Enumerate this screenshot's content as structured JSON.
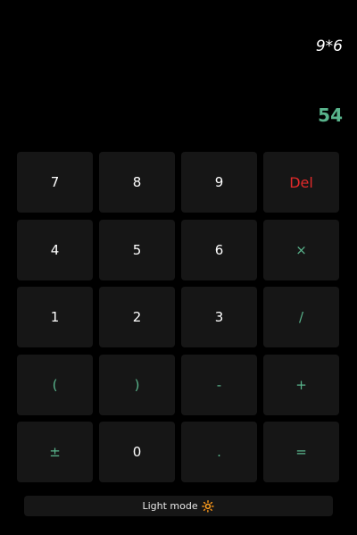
{
  "display": {
    "expression": "9*6",
    "result": "54"
  },
  "colors": {
    "background": "#000000",
    "key_background": "#161616",
    "number_text": "#ffffff",
    "operator_text": "#59b48c",
    "delete_text": "#e22a2a",
    "result_text": "#59b48c",
    "sun_icon": "#ff9a2e"
  },
  "keys": [
    {
      "label": "7",
      "kind": "num",
      "name": "key-7"
    },
    {
      "label": "8",
      "kind": "num",
      "name": "key-8"
    },
    {
      "label": "9",
      "kind": "num",
      "name": "key-9"
    },
    {
      "label": "Del",
      "kind": "del",
      "name": "delete-button"
    },
    {
      "label": "4",
      "kind": "num",
      "name": "key-4"
    },
    {
      "label": "5",
      "kind": "num",
      "name": "key-5"
    },
    {
      "label": "6",
      "kind": "num",
      "name": "key-6"
    },
    {
      "label": "×",
      "kind": "op",
      "name": "multiply-button"
    },
    {
      "label": "1",
      "kind": "num",
      "name": "key-1"
    },
    {
      "label": "2",
      "kind": "num",
      "name": "key-2"
    },
    {
      "label": "3",
      "kind": "num",
      "name": "key-3"
    },
    {
      "label": "/",
      "kind": "op",
      "name": "divide-button"
    },
    {
      "label": "(",
      "kind": "op",
      "name": "open-paren-button"
    },
    {
      "label": ")",
      "kind": "op",
      "name": "close-paren-button"
    },
    {
      "label": "-",
      "kind": "op",
      "name": "subtract-button"
    },
    {
      "label": "+",
      "kind": "op",
      "name": "add-button"
    },
    {
      "label": "±",
      "kind": "op",
      "name": "toggle-sign-button"
    },
    {
      "label": "0",
      "kind": "num",
      "name": "key-0"
    },
    {
      "label": ".",
      "kind": "op",
      "name": "decimal-button"
    },
    {
      "label": "=",
      "kind": "op",
      "name": "equals-button"
    }
  ],
  "mode_toggle": {
    "label": "Light mode",
    "icon": "sun-icon",
    "icon_glyph": "🔆"
  }
}
